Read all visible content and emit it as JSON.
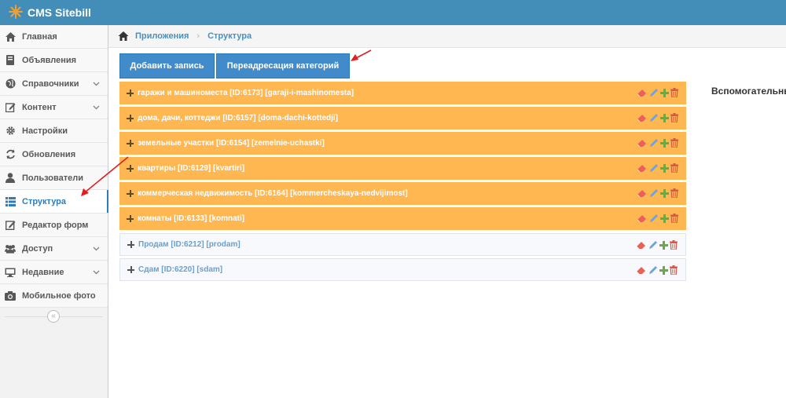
{
  "app": {
    "title": "CMS Sitebill"
  },
  "sidebar": {
    "items": [
      {
        "label": "Главная",
        "icon": "home-icon"
      },
      {
        "label": "Объявления",
        "icon": "book-icon"
      },
      {
        "label": "Справочники",
        "icon": "globe-icon",
        "has_children": true
      },
      {
        "label": "Контент",
        "icon": "edit-icon",
        "has_children": true
      },
      {
        "label": "Настройки",
        "icon": "gear-icon"
      },
      {
        "label": "Обновления",
        "icon": "refresh-icon"
      },
      {
        "label": "Пользователи",
        "icon": "user-icon"
      },
      {
        "label": "Структура",
        "icon": "list-icon",
        "active": true
      },
      {
        "label": "Редактор форм",
        "icon": "form-edit-icon"
      },
      {
        "label": "Доступ",
        "icon": "users-icon",
        "has_children": true
      },
      {
        "label": "Недавние",
        "icon": "monitor-icon",
        "has_children": true
      },
      {
        "label": "Мобильное фото",
        "icon": "camera-icon"
      }
    ],
    "collapse_symbol": "«"
  },
  "breadcrumb": {
    "items": [
      "Приложения",
      "Структура"
    ]
  },
  "toolbar": {
    "add_label": "Добавить запись",
    "redirect_label": "Переадресация категорий"
  },
  "categories": [
    {
      "label": "гаражи и машиноместа [ID:6173] [garaji-i-mashinomesta]",
      "style": "orange"
    },
    {
      "label": "дома, дачи, коттеджи [ID:6157] [doma-dachi-kottedji]",
      "style": "orange"
    },
    {
      "label": "земельные участки [ID:6154] [zemelnie-uchastki]",
      "style": "orange"
    },
    {
      "label": "квартиры [ID:6129] [kvartiri]",
      "style": "orange"
    },
    {
      "label": "коммерческая недвижимость [ID:6164] [kommercheskaya-nedvijimost]",
      "style": "orange"
    },
    {
      "label": "комнаты [ID:6133] [komnati]",
      "style": "orange"
    },
    {
      "label": "Продам [ID:6212] [prodam]",
      "style": "light"
    },
    {
      "label": "Сдам [ID:6220] [sdam]",
      "style": "light"
    }
  ],
  "aux_panel": {
    "title": "Вспомогательные"
  },
  "colors": {
    "navbar": "#438eb9",
    "accent": "#2b7dbc",
    "row_orange": "#ffb752",
    "row_light": "#f7f9fc",
    "eraser": "#e8615a",
    "pencil": "#6fa2d8",
    "plus": "#69aa46",
    "trash": "#d15b47",
    "annotation_arrow": "#e02020"
  }
}
